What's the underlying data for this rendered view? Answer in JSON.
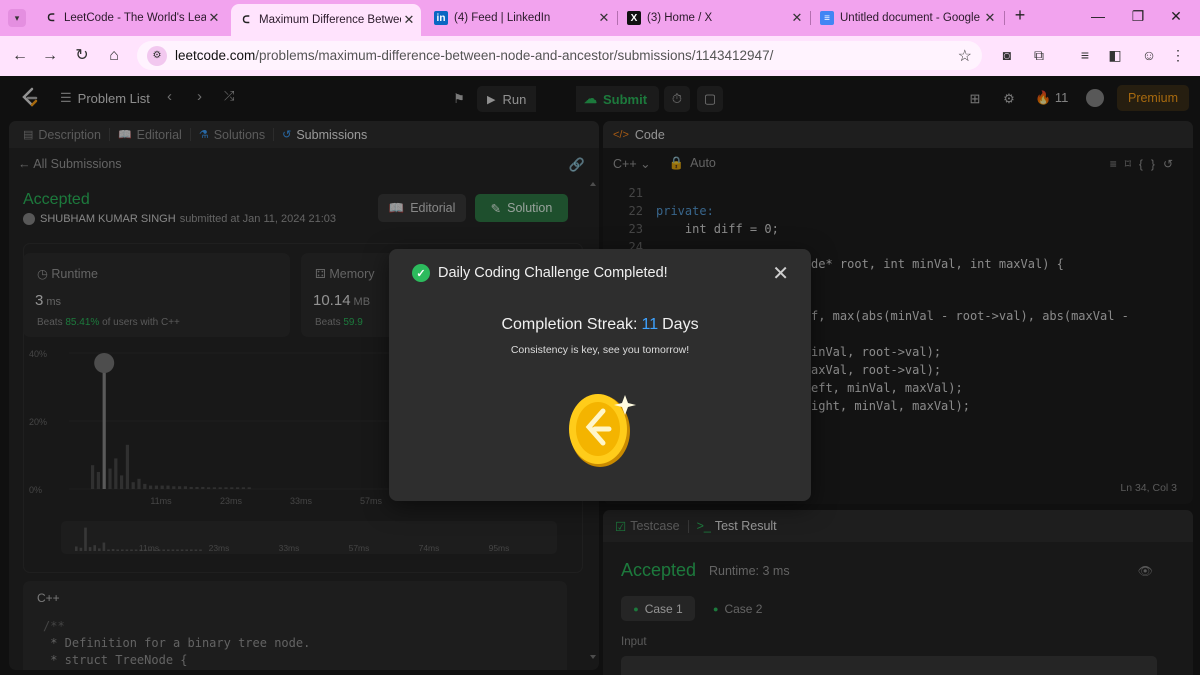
{
  "browser": {
    "tabs": [
      {
        "title": "LeetCode - The World's Leading",
        "active": false,
        "favicon": "leetcode-icon"
      },
      {
        "title": "Maximum Difference Between",
        "active": true,
        "favicon": "leetcode-icon"
      },
      {
        "title": "(4) Feed | LinkedIn",
        "active": false,
        "favicon": "linkedin-icon",
        "favicon_text": "in"
      },
      {
        "title": "(3) Home / X",
        "active": false,
        "favicon": "x-icon",
        "favicon_text": "X"
      },
      {
        "title": "Untitled document - Google",
        "active": false,
        "favicon": "docs-icon",
        "favicon_text": "≡"
      }
    ],
    "new_tab": "+",
    "url_host": "leetcode.com",
    "url_path": "/problems/maximum-difference-between-node-and-ancestor/submissions/1143412947/"
  },
  "nav": {
    "problem_list": "Problem List",
    "run": "Run",
    "submit": "Submit",
    "streak_count": "11",
    "premium": "Premium"
  },
  "left": {
    "tabs": [
      "Description",
      "Editorial",
      "Solutions",
      "Submissions"
    ],
    "all_submissions": "All Submissions",
    "status": "Accepted",
    "author": "SHUBHAM KUMAR SINGH",
    "submitted_at": "submitted at Jan 11, 2024 21:03",
    "editorial_btn": "Editorial",
    "solution_btn": "Solution",
    "runtime": {
      "label": "Runtime",
      "value": "3",
      "unit": "ms",
      "beats_prefix": "Beats",
      "beats_pct": "85.41%",
      "beats_suffix": "of users with C++"
    },
    "memory": {
      "label": "Memory",
      "value": "10.14",
      "unit": "MB",
      "beats_prefix": "Beats",
      "beats_pct": "59.9"
    },
    "language": "C++",
    "code_preview": [
      "/**",
      " * Definition for a binary tree node.",
      " * struct TreeNode {"
    ]
  },
  "chart_data": {
    "type": "bar",
    "ylabel_ticks": [
      "40%",
      "20%",
      "0%"
    ],
    "ylim": [
      0,
      40
    ],
    "x_ticks": [
      "11ms",
      "23ms",
      "33ms",
      "57ms"
    ],
    "mini_ticks": [
      "11ms",
      "23ms",
      "33ms",
      "57ms",
      "74ms",
      "95ms"
    ],
    "highlight": "3ms",
    "values": [
      7,
      5,
      36,
      6,
      9,
      4,
      13,
      2,
      3,
      1.5,
      1,
      1,
      1,
      1,
      0.8,
      0.8,
      0.8,
      0.6,
      0.6,
      0.6,
      0.5,
      0.5,
      0.5,
      0.5,
      0.5,
      0.5,
      0.5,
      0.5
    ]
  },
  "code": {
    "header": "Code",
    "language": "C++",
    "mode": "Auto",
    "lines": [
      {
        "n": "21",
        "text": ""
      },
      {
        "n": "22",
        "text": "private:"
      },
      {
        "n": "23",
        "text": "    int diff = 0;"
      },
      {
        "n": "24",
        "text": ""
      }
    ],
    "frag1": "de* root, int minVal, int maxVal) {",
    "frag2": "f, max(abs(minVal - root->val), abs(maxVal -",
    "frag3": "inVal, root->val);",
    "frag4": "axVal, root->val);",
    "frag5": "eft, minVal, maxVal);",
    "frag6": "ight, minVal, maxVal);",
    "cursor": "Ln 34, Col 3"
  },
  "test": {
    "testcase_tab": "Testcase",
    "result_tab": "Test Result",
    "status": "Accepted",
    "runtime": "Runtime: 3 ms",
    "case1": "Case 1",
    "case2": "Case 2",
    "input_label": "Input"
  },
  "modal": {
    "title": "Daily Coding Challenge Completed!",
    "streak_label": "Completion Streak:",
    "streak_value": "11",
    "streak_unit": "Days",
    "subtitle": "Consistency is key, see you tomorrow!"
  },
  "colors": {
    "accent_green": "#2cbb5d",
    "accent_orange": "#ffa116",
    "streak_blue": "#3ea2ff",
    "tabbar": "#f2a3ee"
  }
}
